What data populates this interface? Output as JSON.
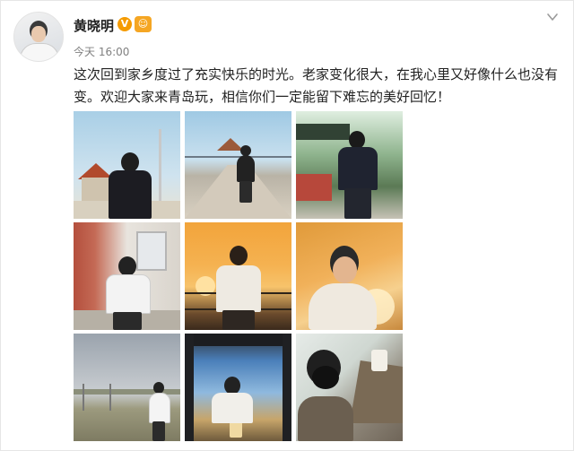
{
  "post": {
    "username": "黄晓明",
    "verified_badge": "V",
    "level_badge": "☺",
    "timestamp": "今天 16:00",
    "text": "这次回到家乡度过了充实快乐的时光。老家变化很大，在我心里又好像什么也没有变。欢迎大家来青岛玩，相信你们一定能留下难忘的美好回忆！"
  },
  "icons": {
    "avatar": "avatar-photo",
    "menu": "chevron-down-icon",
    "verified": "verified-v-badge",
    "level": "member-badge"
  },
  "colors": {
    "verified_badge": "#f59b00",
    "level_badge": "#f5a623",
    "timestamp": "#808080",
    "text": "#222222"
  },
  "photos": [
    {
      "scene": "pavilion-blue-sky"
    },
    {
      "scene": "pier-walkway"
    },
    {
      "scene": "garden-tree-street"
    },
    {
      "scene": "brick-building-stairs"
    },
    {
      "scene": "sunset-railing"
    },
    {
      "scene": "sunset-closeup"
    },
    {
      "scene": "field-overcast"
    },
    {
      "scene": "car-trunk-camping"
    },
    {
      "scene": "cafe-closeup"
    }
  ]
}
